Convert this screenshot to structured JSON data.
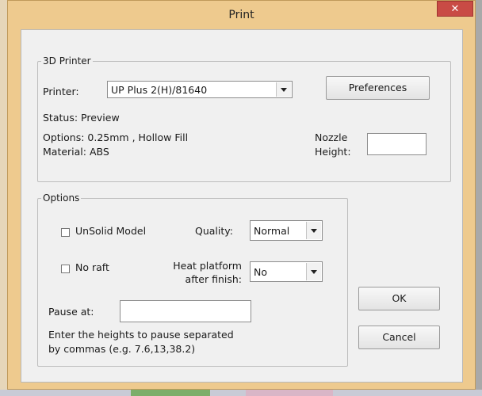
{
  "dialog": {
    "title": "Print",
    "close_icon": "close-icon",
    "close_glyph": "✕"
  },
  "printer_group": {
    "legend": "3D Printer",
    "printer_label": "Printer:",
    "printer_value": "UP Plus 2(H)/81640",
    "preferences_button": "Preferences",
    "status": "Status: Preview",
    "options_line": "Options: 0.25mm , Hollow Fill",
    "material_line": "Material: ABS",
    "nozzle_label_1": "Nozzle",
    "nozzle_label_2": "Height:",
    "nozzle_value": ""
  },
  "options_group": {
    "legend": "Options",
    "unsolid_label": "UnSolid Model",
    "unsolid_checked": false,
    "quality_label": "Quality:",
    "quality_value": "Normal",
    "noraft_label": "No raft",
    "noraft_checked": false,
    "heat_label_1": "Heat platform",
    "heat_label_2": "after finish:",
    "heat_value": "No",
    "pause_label": "Pause at:",
    "pause_value": "",
    "hint_line_1": "Enter the heights to pause separated",
    "hint_line_2": "by commas (e.g. 7.6,13,38.2)"
  },
  "buttons": {
    "ok": "OK",
    "cancel": "Cancel"
  },
  "colors": {
    "titlebar": "#eeca8e",
    "close_button": "#c94b45",
    "client_bg": "#f0f0f0"
  }
}
